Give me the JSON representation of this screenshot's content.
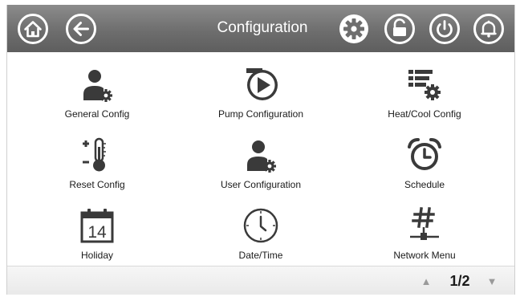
{
  "header": {
    "title": "Configuration",
    "buttons": {
      "home": "home-icon",
      "back": "back-arrow-icon",
      "settings": "gear-icon",
      "lock": "unlock-icon",
      "power": "power-icon",
      "alarm": "bell-icon"
    }
  },
  "menu": {
    "items": [
      {
        "label": "General Config",
        "icon": "user-gear-icon"
      },
      {
        "label": "Pump Configuration",
        "icon": "pump-icon"
      },
      {
        "label": "Heat/Cool Config",
        "icon": "list-gear-icon"
      },
      {
        "label": "Reset Config",
        "icon": "thermometer-icon"
      },
      {
        "label": "User Configuration",
        "icon": "user-gear-icon"
      },
      {
        "label": "Schedule",
        "icon": "alarm-clock-icon"
      },
      {
        "label": "Holiday",
        "icon": "calendar-icon",
        "day": "14"
      },
      {
        "label": "Date/Time",
        "icon": "clock-icon"
      },
      {
        "label": "Network Menu",
        "icon": "network-icon"
      }
    ]
  },
  "pager": {
    "indicator": "1/2",
    "up": "▲",
    "down": "▼"
  },
  "colors": {
    "topbar": "#6e6e6e",
    "icon": "#3a3a3a",
    "text": "#1a1a1a"
  }
}
